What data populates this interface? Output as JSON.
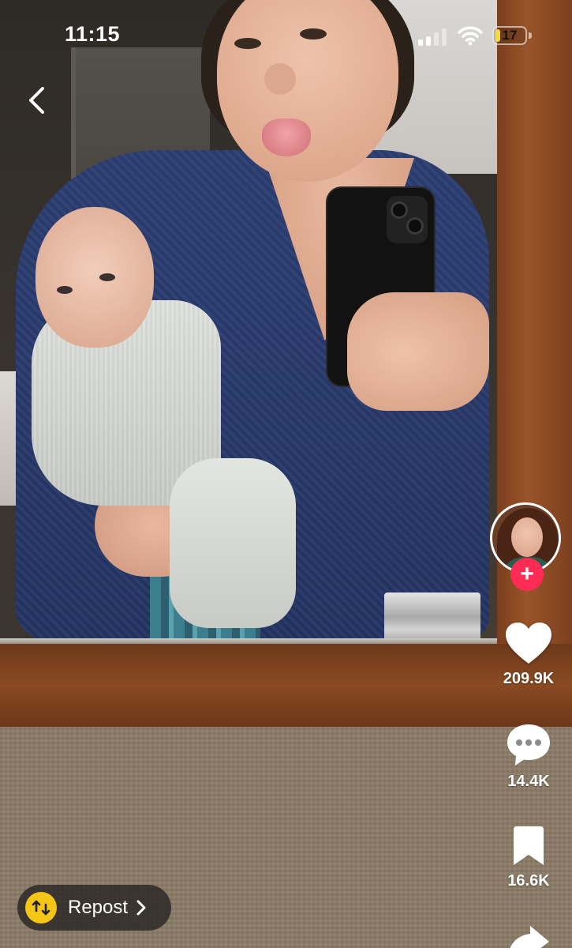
{
  "status_bar": {
    "time": "11:15",
    "battery_level": "17",
    "battery_fraction": 0.17,
    "battery_color": "#f5d74a"
  },
  "navigation": {
    "back_icon": "chevron-left-icon"
  },
  "creator": {
    "avatar_icon": "profile-photo",
    "follow_label": "+",
    "follow_color": "#fe2c55"
  },
  "actions": {
    "likes": {
      "icon": "heart-icon",
      "count": "209.9K"
    },
    "comments": {
      "icon": "comment-bubble-icon",
      "count": "14.4K"
    },
    "saves": {
      "icon": "bookmark-icon",
      "count": "16.6K"
    },
    "share": {
      "icon": "share-arrow-icon"
    }
  },
  "repost": {
    "icon": "repost-icon",
    "icon_color": "#f5c518",
    "label": "Repost",
    "chevron": "chevron-right-icon"
  }
}
